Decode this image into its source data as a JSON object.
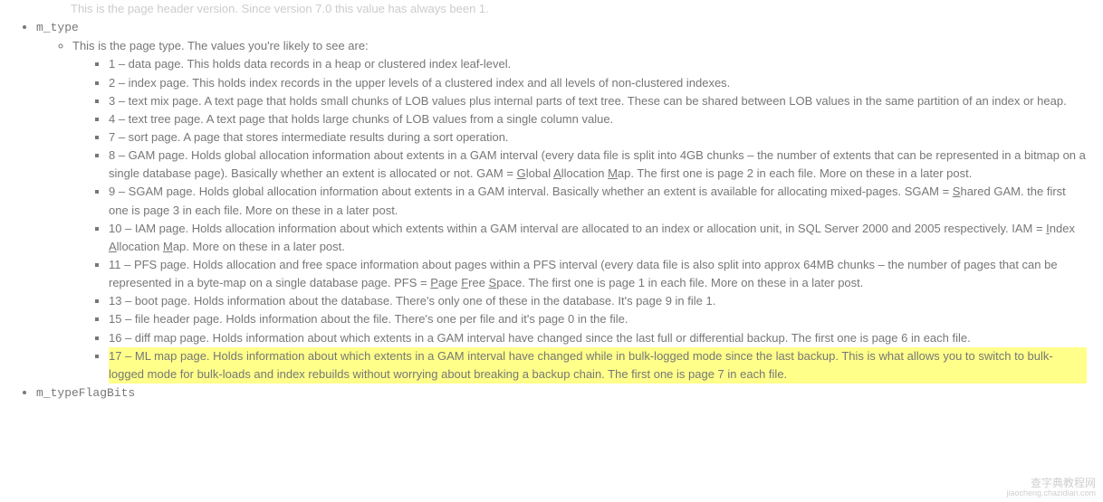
{
  "partial_top": "This is the page header version. Since version 7.0 this value has always been 1.",
  "fields": {
    "m_type": {
      "label": "m_type",
      "intro": "This is the page type. The values you're likely to see are:",
      "items": [
        {
          "text": "1 – data page. This holds data records in a heap or clustered index leaf-level."
        },
        {
          "text": "2 – index page. This holds index records in the upper levels of a clustered index and all levels of non-clustered indexes."
        },
        {
          "text": "3 – text mix page. A text page that holds small chunks of LOB values plus internal parts of text tree. These can be shared between LOB values in the same partition of an index or heap."
        },
        {
          "text": "4 – text tree page. A text page that holds large chunks of LOB values from a single column value."
        },
        {
          "text": "7 – sort page. A page that stores intermediate results during a sort operation."
        },
        {
          "html": "8 – GAM page. Holds global allocation information about extents in a GAM interval (every data file is split into 4GB chunks – the number of extents that can be represented in a bitmap on a single database page). Basically whether an extent is allocated or not. GAM = <span class='u'>G</span>lobal <span class='u'>A</span>llocation <span class='u'>M</span>ap. The first one is page 2 in each file. More on these in a later post."
        },
        {
          "html": "9 – SGAM page. Holds global allocation information about extents in a GAM interval. Basically whether an extent is available for allocating mixed-pages. SGAM = <span class='u'>S</span>hared GAM. the first one is page 3 in each file. More on these in a later post."
        },
        {
          "html": "10 – IAM page. Holds allocation information about which extents within a GAM interval are allocated to an index or allocation unit, in SQL Server 2000 and 2005 respectively. IAM = <span class='u'>I</span>ndex <span class='u'>A</span>llocation <span class='u'>M</span>ap. More on these in a later post."
        },
        {
          "html": "11 – PFS page. Holds allocation and free space information about pages within a PFS interval (every data file is also split into approx 64MB chunks – the number of pages that can be represented in a byte-map on a single database page. PFS = <span class='u'>P</span>age <span class='u'>F</span>ree <span class='u'>S</span>pace. The first one is page 1 in each file. More on these in a later post."
        },
        {
          "text": "13 – boot page. Holds information about the database. There's only one of these in the database. It's page 9 in file 1."
        },
        {
          "text": "15 – file header page. Holds information about the file. There's one per file and it's page 0 in the file."
        },
        {
          "text": "16 – diff map page. Holds information about which extents in a GAM interval have changed since the last full or differential backup. The first one is page 6 in each file."
        },
        {
          "text": "17 – ML map page. Holds information about which extents in a GAM interval have changed while in bulk-logged mode since the last backup. This is what allows you to switch to bulk-logged mode for bulk-loads and index rebuilds without worrying about breaking a backup chain. The first one is page 7 in each file.",
          "highlight": true
        }
      ]
    },
    "m_typeFlagBits": {
      "label": "m_typeFlagBits"
    }
  },
  "watermark": {
    "line1": "查字典教程网",
    "line2": "jiaocheng.chazidian.com"
  }
}
